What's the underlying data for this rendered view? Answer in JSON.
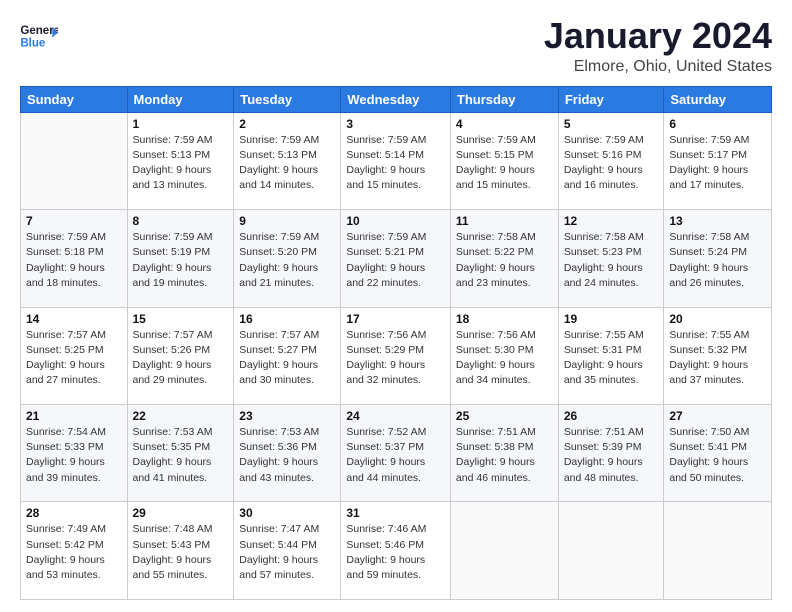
{
  "logo": {
    "line1": "General",
    "line2": "Blue"
  },
  "title": "January 2024",
  "subtitle": "Elmore, Ohio, United States",
  "weekdays": [
    "Sunday",
    "Monday",
    "Tuesday",
    "Wednesday",
    "Thursday",
    "Friday",
    "Saturday"
  ],
  "weeks": [
    [
      {
        "day": "",
        "info": ""
      },
      {
        "day": "1",
        "info": "Sunrise: 7:59 AM\nSunset: 5:13 PM\nDaylight: 9 hours\nand 13 minutes."
      },
      {
        "day": "2",
        "info": "Sunrise: 7:59 AM\nSunset: 5:13 PM\nDaylight: 9 hours\nand 14 minutes."
      },
      {
        "day": "3",
        "info": "Sunrise: 7:59 AM\nSunset: 5:14 PM\nDaylight: 9 hours\nand 15 minutes."
      },
      {
        "day": "4",
        "info": "Sunrise: 7:59 AM\nSunset: 5:15 PM\nDaylight: 9 hours\nand 15 minutes."
      },
      {
        "day": "5",
        "info": "Sunrise: 7:59 AM\nSunset: 5:16 PM\nDaylight: 9 hours\nand 16 minutes."
      },
      {
        "day": "6",
        "info": "Sunrise: 7:59 AM\nSunset: 5:17 PM\nDaylight: 9 hours\nand 17 minutes."
      }
    ],
    [
      {
        "day": "7",
        "info": "Sunrise: 7:59 AM\nSunset: 5:18 PM\nDaylight: 9 hours\nand 18 minutes."
      },
      {
        "day": "8",
        "info": "Sunrise: 7:59 AM\nSunset: 5:19 PM\nDaylight: 9 hours\nand 19 minutes."
      },
      {
        "day": "9",
        "info": "Sunrise: 7:59 AM\nSunset: 5:20 PM\nDaylight: 9 hours\nand 21 minutes."
      },
      {
        "day": "10",
        "info": "Sunrise: 7:59 AM\nSunset: 5:21 PM\nDaylight: 9 hours\nand 22 minutes."
      },
      {
        "day": "11",
        "info": "Sunrise: 7:58 AM\nSunset: 5:22 PM\nDaylight: 9 hours\nand 23 minutes."
      },
      {
        "day": "12",
        "info": "Sunrise: 7:58 AM\nSunset: 5:23 PM\nDaylight: 9 hours\nand 24 minutes."
      },
      {
        "day": "13",
        "info": "Sunrise: 7:58 AM\nSunset: 5:24 PM\nDaylight: 9 hours\nand 26 minutes."
      }
    ],
    [
      {
        "day": "14",
        "info": "Sunrise: 7:57 AM\nSunset: 5:25 PM\nDaylight: 9 hours\nand 27 minutes."
      },
      {
        "day": "15",
        "info": "Sunrise: 7:57 AM\nSunset: 5:26 PM\nDaylight: 9 hours\nand 29 minutes."
      },
      {
        "day": "16",
        "info": "Sunrise: 7:57 AM\nSunset: 5:27 PM\nDaylight: 9 hours\nand 30 minutes."
      },
      {
        "day": "17",
        "info": "Sunrise: 7:56 AM\nSunset: 5:29 PM\nDaylight: 9 hours\nand 32 minutes."
      },
      {
        "day": "18",
        "info": "Sunrise: 7:56 AM\nSunset: 5:30 PM\nDaylight: 9 hours\nand 34 minutes."
      },
      {
        "day": "19",
        "info": "Sunrise: 7:55 AM\nSunset: 5:31 PM\nDaylight: 9 hours\nand 35 minutes."
      },
      {
        "day": "20",
        "info": "Sunrise: 7:55 AM\nSunset: 5:32 PM\nDaylight: 9 hours\nand 37 minutes."
      }
    ],
    [
      {
        "day": "21",
        "info": "Sunrise: 7:54 AM\nSunset: 5:33 PM\nDaylight: 9 hours\nand 39 minutes."
      },
      {
        "day": "22",
        "info": "Sunrise: 7:53 AM\nSunset: 5:35 PM\nDaylight: 9 hours\nand 41 minutes."
      },
      {
        "day": "23",
        "info": "Sunrise: 7:53 AM\nSunset: 5:36 PM\nDaylight: 9 hours\nand 43 minutes."
      },
      {
        "day": "24",
        "info": "Sunrise: 7:52 AM\nSunset: 5:37 PM\nDaylight: 9 hours\nand 44 minutes."
      },
      {
        "day": "25",
        "info": "Sunrise: 7:51 AM\nSunset: 5:38 PM\nDaylight: 9 hours\nand 46 minutes."
      },
      {
        "day": "26",
        "info": "Sunrise: 7:51 AM\nSunset: 5:39 PM\nDaylight: 9 hours\nand 48 minutes."
      },
      {
        "day": "27",
        "info": "Sunrise: 7:50 AM\nSunset: 5:41 PM\nDaylight: 9 hours\nand 50 minutes."
      }
    ],
    [
      {
        "day": "28",
        "info": "Sunrise: 7:49 AM\nSunset: 5:42 PM\nDaylight: 9 hours\nand 53 minutes."
      },
      {
        "day": "29",
        "info": "Sunrise: 7:48 AM\nSunset: 5:43 PM\nDaylight: 9 hours\nand 55 minutes."
      },
      {
        "day": "30",
        "info": "Sunrise: 7:47 AM\nSunset: 5:44 PM\nDaylight: 9 hours\nand 57 minutes."
      },
      {
        "day": "31",
        "info": "Sunrise: 7:46 AM\nSunset: 5:46 PM\nDaylight: 9 hours\nand 59 minutes."
      },
      {
        "day": "",
        "info": ""
      },
      {
        "day": "",
        "info": ""
      },
      {
        "day": "",
        "info": ""
      }
    ]
  ]
}
